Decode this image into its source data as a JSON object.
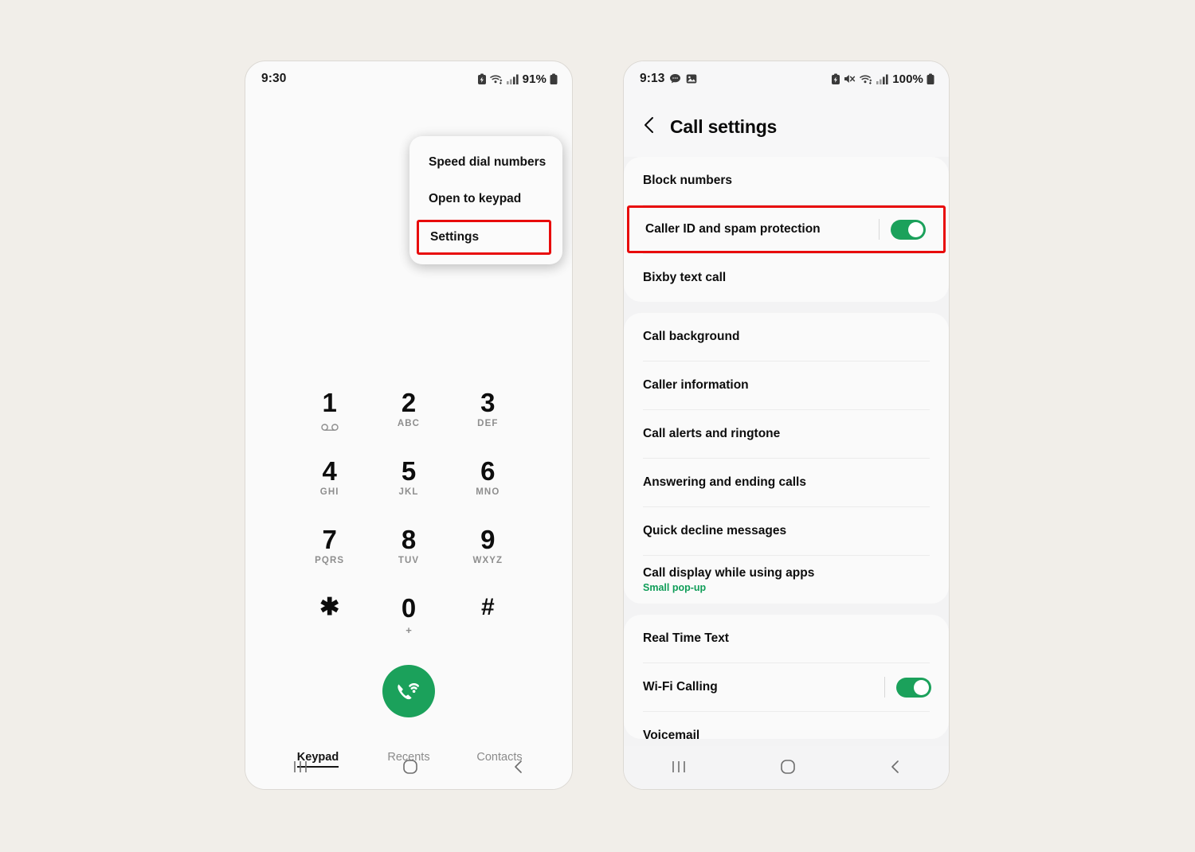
{
  "page": {
    "background_color": "#F1EEE9",
    "highlight_color": "#E80B0B",
    "accent_green": "#1BA15B"
  },
  "left_phone": {
    "status_bar": {
      "time": "9:30",
      "battery_percent": "91%",
      "icons": [
        "battery-saver-icon",
        "wifi-icon",
        "signal-icon",
        "battery-icon"
      ]
    },
    "overflow_menu": {
      "items": [
        {
          "label": "Speed dial numbers",
          "highlighted": false
        },
        {
          "label": "Open to keypad",
          "highlighted": false
        },
        {
          "label": "Settings",
          "highlighted": true
        }
      ]
    },
    "keypad": [
      {
        "digit": "1",
        "letters": "",
        "icon": "voicemail-icon"
      },
      {
        "digit": "2",
        "letters": "ABC",
        "icon": ""
      },
      {
        "digit": "3",
        "letters": "DEF",
        "icon": ""
      },
      {
        "digit": "4",
        "letters": "GHI",
        "icon": ""
      },
      {
        "digit": "5",
        "letters": "JKL",
        "icon": ""
      },
      {
        "digit": "6",
        "letters": "MNO",
        "icon": ""
      },
      {
        "digit": "7",
        "letters": "PQRS",
        "icon": ""
      },
      {
        "digit": "8",
        "letters": "TUV",
        "icon": ""
      },
      {
        "digit": "9",
        "letters": "WXYZ",
        "icon": ""
      },
      {
        "digit": "✱",
        "letters": "",
        "icon": ""
      },
      {
        "digit": "0",
        "letters": "+",
        "icon": ""
      },
      {
        "digit": "#",
        "letters": "",
        "icon": ""
      }
    ],
    "call_button": {
      "icon": "wifi-call-icon",
      "color": "#1BA15B"
    },
    "tabs": [
      {
        "label": "Keypad",
        "active": true
      },
      {
        "label": "Recents",
        "active": false
      },
      {
        "label": "Contacts",
        "active": false
      }
    ],
    "nav_bar": [
      "recents-icon",
      "home-icon",
      "back-icon"
    ]
  },
  "right_phone": {
    "status_bar": {
      "time": "9:13",
      "battery_percent": "100%",
      "left_icons": [
        "message-icon",
        "photo-icon"
      ],
      "right_icons": [
        "battery-saver-icon",
        "mute-icon",
        "wifi-icon",
        "signal-icon",
        "battery-icon"
      ]
    },
    "header": {
      "back_icon": "back-chevron-icon",
      "title": "Call settings"
    },
    "groups": [
      {
        "rows": [
          {
            "title": "Block numbers",
            "subtitle": "",
            "toggle": null,
            "highlighted": false
          },
          {
            "title": "Caller ID and spam protection",
            "subtitle": "",
            "toggle": "on",
            "highlighted": true
          },
          {
            "title": "Bixby text call",
            "subtitle": "",
            "toggle": null,
            "highlighted": false
          }
        ]
      },
      {
        "rows": [
          {
            "title": "Call background",
            "subtitle": "",
            "toggle": null,
            "highlighted": false
          },
          {
            "title": "Caller information",
            "subtitle": "",
            "toggle": null,
            "highlighted": false
          },
          {
            "title": "Call alerts and ringtone",
            "subtitle": "",
            "toggle": null,
            "highlighted": false
          },
          {
            "title": "Answering and ending calls",
            "subtitle": "",
            "toggle": null,
            "highlighted": false
          },
          {
            "title": "Quick decline messages",
            "subtitle": "",
            "toggle": null,
            "highlighted": false
          },
          {
            "title": "Call display while using apps",
            "subtitle": "Small pop-up",
            "toggle": null,
            "highlighted": false
          }
        ]
      },
      {
        "rows": [
          {
            "title": "Real Time Text",
            "subtitle": "",
            "toggle": null,
            "highlighted": false
          },
          {
            "title": "Wi-Fi Calling",
            "subtitle": "",
            "toggle": "on",
            "highlighted": false
          },
          {
            "title": "Voicemail",
            "subtitle": "",
            "toggle": null,
            "highlighted": false,
            "clipped": true
          }
        ]
      }
    ],
    "nav_bar": [
      "recents-icon",
      "home-icon",
      "back-icon"
    ]
  }
}
